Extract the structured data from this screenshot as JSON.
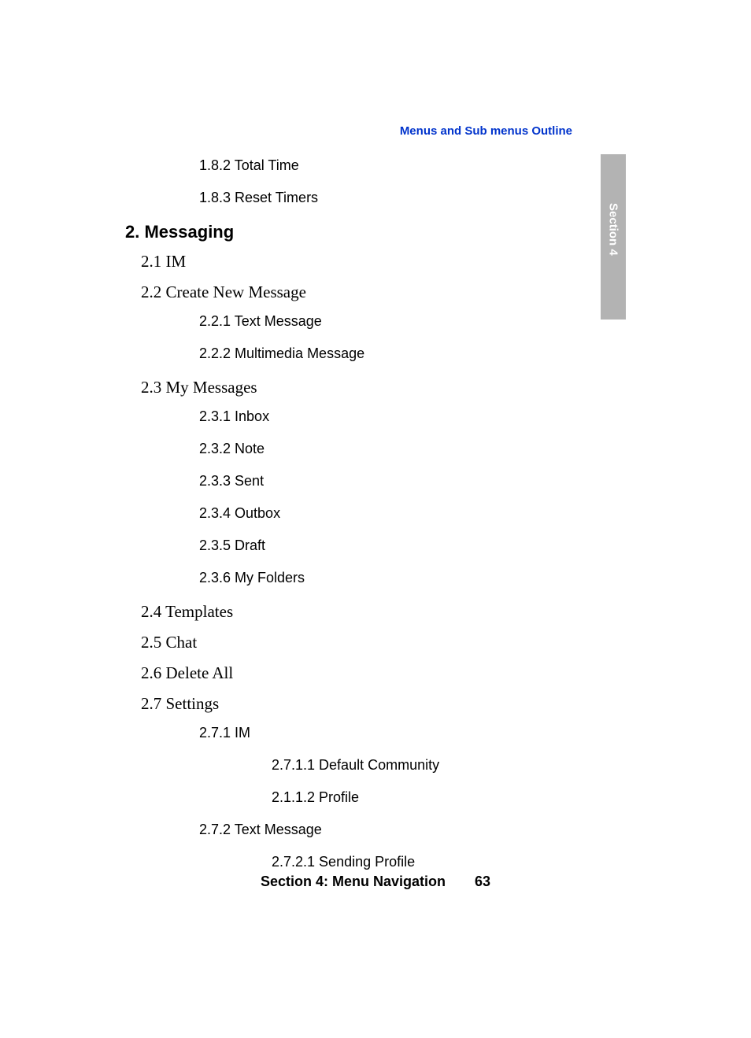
{
  "header": {
    "breadcrumb": "Menus and Sub menus Outline"
  },
  "sidebar": {
    "tab_label": "Section 4"
  },
  "outline": {
    "pre_items": [
      "1.8.2 Total Time",
      "1.8.3 Reset Timers"
    ],
    "section": {
      "number": "2.",
      "title": "Messaging",
      "items": [
        {
          "label": "2.1 IM"
        },
        {
          "label": "2.2 Create New Message",
          "children": [
            "2.2.1 Text Message",
            "2.2.2 Multimedia Message"
          ]
        },
        {
          "label": "2.3 My Messages",
          "children": [
            "2.3.1 Inbox",
            "2.3.2 Note",
            "2.3.3 Sent",
            "2.3.4 Outbox",
            "2.3.5 Draft",
            "2.3.6 My Folders"
          ]
        },
        {
          "label": "2.4 Templates"
        },
        {
          "label": "2.5 Chat"
        },
        {
          "label": "2.6 Delete All"
        },
        {
          "label": "2.7 Settings",
          "children": [
            {
              "label": "2.7.1 IM",
              "children": [
                "2.7.1.1 Default Community",
                "2.1.1.2 Profile"
              ]
            },
            {
              "label": "2.7.2 Text Message",
              "children": [
                "2.7.2.1 Sending Profile"
              ]
            }
          ]
        }
      ]
    }
  },
  "footer": {
    "section_label": "Section 4: Menu Navigation",
    "page_number": "63"
  }
}
